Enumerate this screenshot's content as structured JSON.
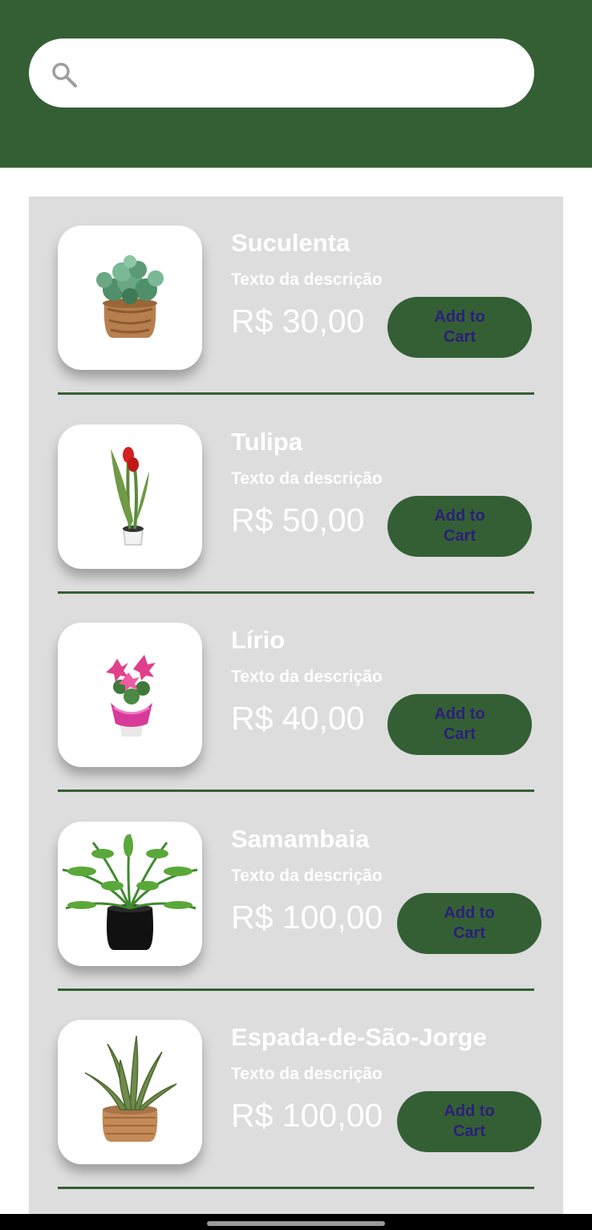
{
  "search": {
    "placeholder": "",
    "value": ""
  },
  "products": [
    {
      "name": "Suculenta",
      "description": "Texto da descrição",
      "price": "R$ 30,00",
      "button_label": "Add to Cart",
      "image": "succulent-pot"
    },
    {
      "name": "Tulipa",
      "description": "Texto da descrição",
      "price": "R$ 50,00",
      "button_label": "Add to Cart",
      "image": "red-tulip"
    },
    {
      "name": "Lírio",
      "description": "Texto da descrição",
      "price": "R$ 40,00",
      "button_label": "Add to Cart",
      "image": "pink-lily"
    },
    {
      "name": "Samambaia",
      "description": "Texto da descrição",
      "price": "R$ 100,00",
      "button_label": "Add to Cart",
      "image": "fern-black-pot"
    },
    {
      "name": "Espada-de-São-Jorge",
      "description": "Texto da descrição",
      "price": "R$ 100,00",
      "button_label": "Add to Cart",
      "image": "snake-plant-basket"
    }
  ],
  "colors": {
    "header": "#345f35",
    "list_background": "#dddddd",
    "button": "#345f35",
    "button_text": "#2b1f7a"
  }
}
